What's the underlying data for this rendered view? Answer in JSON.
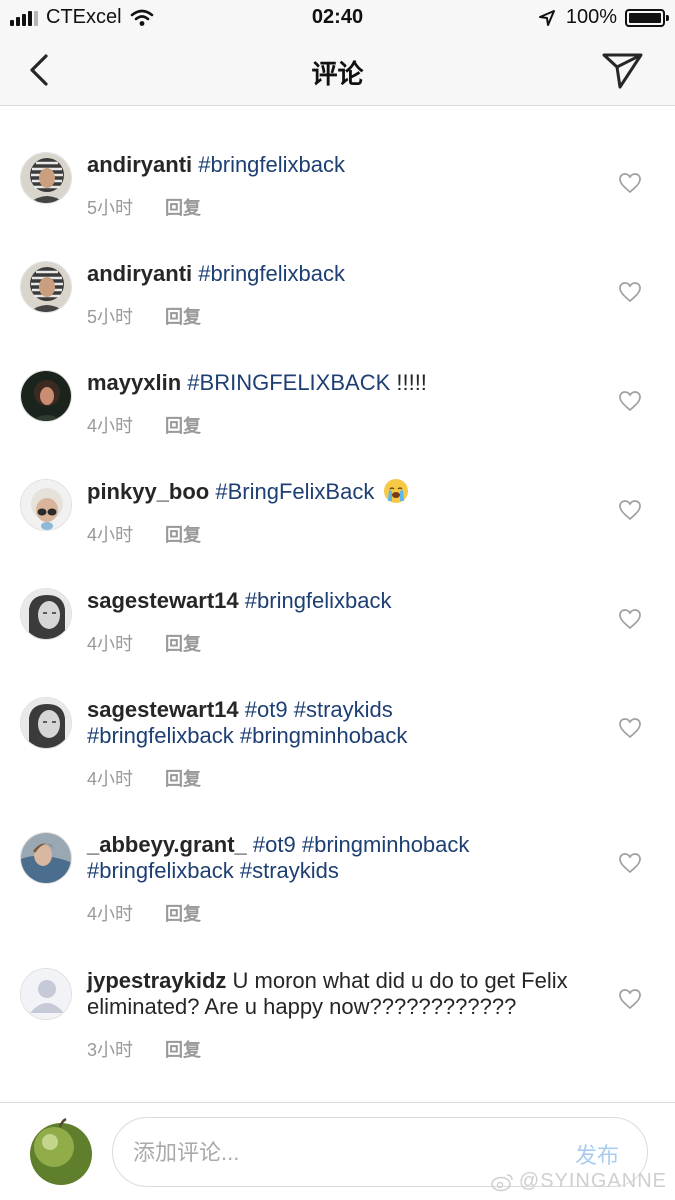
{
  "status_bar": {
    "carrier": "CTExcel",
    "time": "02:40",
    "battery": "100%"
  },
  "nav": {
    "title": "评论"
  },
  "comments": [
    {
      "username": "andiryanti",
      "segments": [
        {
          "text": "#bringfelixback",
          "tag": true
        }
      ],
      "time": "5小时",
      "reply": "回复",
      "avatar": "hijab-portrait"
    },
    {
      "username": "andiryanti",
      "segments": [
        {
          "text": "#bringfelixback",
          "tag": true
        }
      ],
      "time": "5小时",
      "reply": "回复",
      "avatar": "hijab-portrait"
    },
    {
      "username": "mayyxlin",
      "segments": [
        {
          "text": "#BRINGFELIXBACK",
          "tag": true
        },
        {
          "text": " !!!!!",
          "tag": false
        }
      ],
      "time": "4小时",
      "reply": "回复",
      "avatar": "dark-portrait"
    },
    {
      "username": "pinkyy_boo",
      "segments": [
        {
          "text": "#BringFelixBack",
          "tag": true
        }
      ],
      "emoji": "loudly-crying-face",
      "time": "4小时",
      "reply": "回复",
      "avatar": "sunglasses-portrait"
    },
    {
      "username": "sagestewart14",
      "segments": [
        {
          "text": "#bringfelixback",
          "tag": true
        }
      ],
      "time": "4小时",
      "reply": "回复",
      "avatar": "bw-portrait"
    },
    {
      "username": "sagestewart14",
      "segments": [
        {
          "text": "#ot9",
          "tag": true
        },
        {
          "text": " ",
          "tag": false
        },
        {
          "text": "#straykids",
          "tag": true
        },
        {
          "text": " ",
          "tag": false
        },
        {
          "text": "#bringfelixback",
          "tag": true
        },
        {
          "text": " ",
          "tag": false
        },
        {
          "text": "#bringminhoback",
          "tag": true
        }
      ],
      "time": "4小时",
      "reply": "回复",
      "avatar": "bw-portrait"
    },
    {
      "username": "_abbeyy.grant_",
      "segments": [
        {
          "text": "#ot9",
          "tag": true
        },
        {
          "text": " ",
          "tag": false
        },
        {
          "text": "#bringminhoback",
          "tag": true
        },
        {
          "text": " ",
          "tag": false
        },
        {
          "text": "#bringfelixback",
          "tag": true
        },
        {
          "text": " ",
          "tag": false
        },
        {
          "text": "#straykids",
          "tag": true
        }
      ],
      "time": "4小时",
      "reply": "回复",
      "avatar": "blue-portrait"
    },
    {
      "username": "jypestraykidz",
      "segments": [
        {
          "text": "U moron what did u do to get Felix eliminated? Are u happy now????????????",
          "tag": false
        }
      ],
      "time": "3小时",
      "reply": "回复",
      "avatar": "default-avatar"
    }
  ],
  "input": {
    "placeholder": "添加评论...",
    "post_label": "发布"
  },
  "watermark": "@SYINGANNE",
  "icons": {
    "back": "chevron-left-icon",
    "share": "paper-plane-icon",
    "like": "heart-outline-icon",
    "wifi": "wifi-icon",
    "location": "location-arrow-icon",
    "battery": "battery-icon",
    "weibo": "weibo-icon"
  },
  "colors": {
    "hashtag": "#1d3f73",
    "meta": "#999999",
    "post_disabled": "#a9cdf0",
    "bar_bg": "#f7f7f7"
  }
}
